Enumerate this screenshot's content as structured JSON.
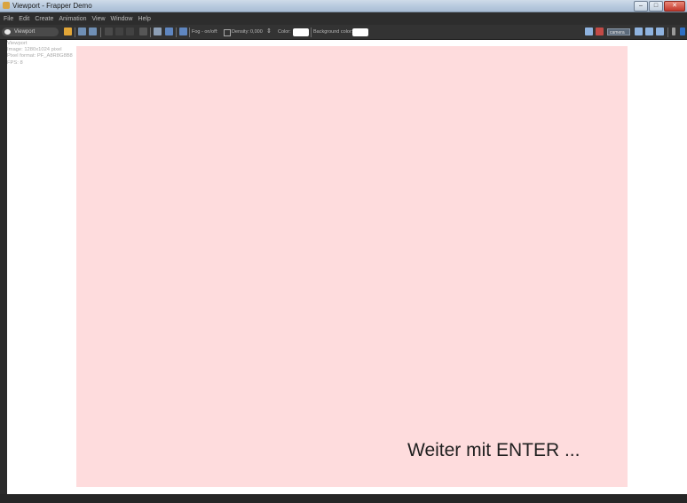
{
  "window": {
    "title": "Viewport - Frapper Demo",
    "controls": {
      "minimize": "–",
      "maximize": "□",
      "close": "✕"
    }
  },
  "menu": [
    "File",
    "Edit",
    "Create",
    "Animation",
    "View",
    "Window",
    "Help"
  ],
  "toolbar": {
    "viewport_tab": "Viewport",
    "fog_label": "Fog - on/off:",
    "density_label": "Density:",
    "density_value": "0,000",
    "color_label": "Color:",
    "background_color_label": "Background color:",
    "camera_combo": "camera",
    "colors": {
      "color_swatch": "#ffffff",
      "background_swatch": "#ffffff"
    }
  },
  "viewport_info": {
    "title": "Viewport",
    "image": "Image: 1280x1024 pixel",
    "pixel_format": "Pixel format: PF_A8R8G8B8",
    "fps": "FPS: 8"
  },
  "viewport": {
    "background": "#fedcdd",
    "prompt": "Weiter mit ENTER ..."
  }
}
